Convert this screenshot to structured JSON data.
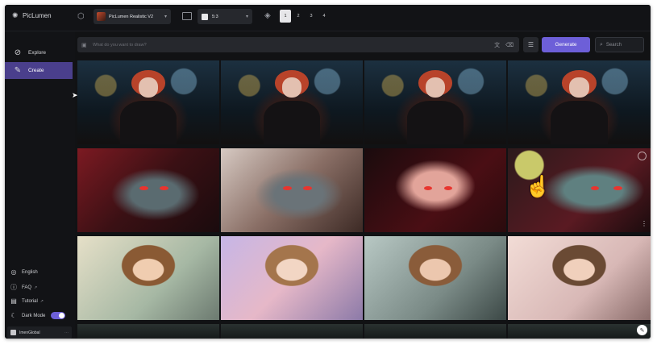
{
  "app": {
    "name": "PicLumen"
  },
  "header": {
    "model_label": "PicLumen Realistic V2",
    "aspect_label": "5:3",
    "batch_counts": [
      "1",
      "2",
      "3",
      "4"
    ],
    "selected_batch": "1"
  },
  "sidebar": {
    "nav": [
      {
        "label": "Explore",
        "icon": "compass-icon",
        "active": false
      },
      {
        "label": "Create",
        "icon": "brush-icon",
        "active": true
      }
    ],
    "footer": {
      "language": "English",
      "faq": "FAQ",
      "tutorial": "Tutorial",
      "dark_mode": "Dark Mode",
      "dark_mode_on": true,
      "user_name": "ImenGlobal"
    }
  },
  "prompt": {
    "placeholder": "What do you want to draw?",
    "generate_label": "Generate",
    "search_placeholder": "Search"
  },
  "gallery": {
    "rows": [
      {
        "subject": "gothic-girl-bubbles",
        "count": 4
      },
      {
        "subject": "red-dragon",
        "count": 4
      },
      {
        "subject": "fairy",
        "count": 4
      },
      {
        "subject": "partial-row",
        "count": 4
      }
    ]
  },
  "colors": {
    "accent": "#6d5fd8",
    "active_nav": "#4a3f8c",
    "background": "#111214",
    "panel": "#26282d"
  }
}
